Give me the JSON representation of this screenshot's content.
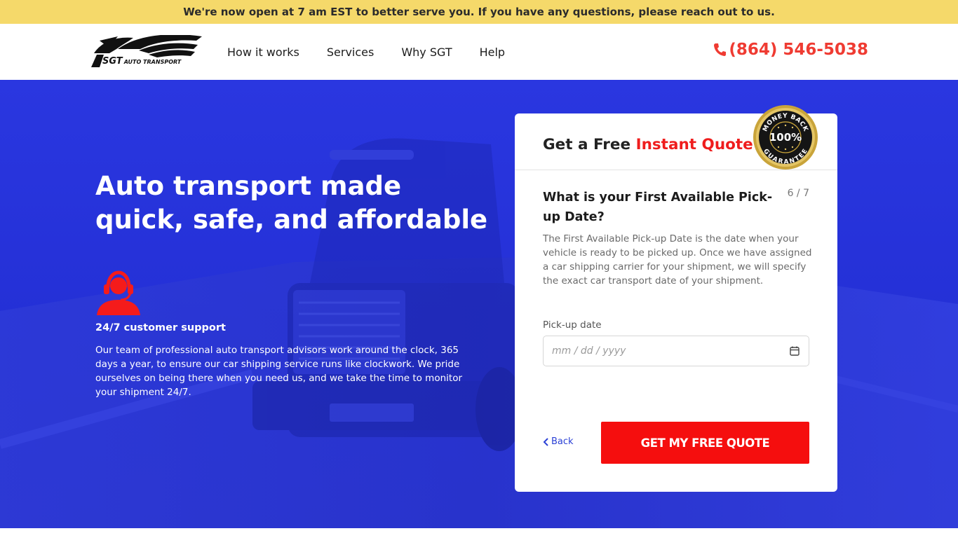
{
  "announcement": {
    "text": "We're now open at 7 am EST to better serve you. If you have any questions, please reach out to us."
  },
  "header": {
    "logo_text": "SGT",
    "logo_subtext": "AUTO TRANSPORT",
    "nav": [
      {
        "label": "How it works"
      },
      {
        "label": "Services"
      },
      {
        "label": "Why SGT"
      },
      {
        "label": "Help"
      }
    ],
    "phone": "(864) 546-5038",
    "phone_icon": "phone-icon",
    "phone_color": "#ef3b32"
  },
  "hero": {
    "title": "Auto transport made quick, safe, and affordable",
    "background_color": "#2430d8",
    "support": {
      "icon": "headset-agent-icon",
      "icon_color": "#f51b1b",
      "title": "24/7 customer support",
      "text": "Our team of professional auto transport advisors work around the clock, 365 days a year, to ensure our car shipping service runs like clockwork. We pride ourselves on being there when you need us, and we take the time to monitor your shipment 24/7."
    }
  },
  "quote_form": {
    "title_prefix": "Get a Free",
    "title_accent": "Instant Quote",
    "accent_color": "#ef1d1d",
    "badge": {
      "top": "MONEY BACK",
      "center": "100%",
      "bottom": "GUARANTEE"
    },
    "step": "6 / 7",
    "question": "What is your First Available Pick-up Date?",
    "description": "The First Available Pick-up Date is the date when your vehicle is ready to be picked up. Once we have assigned a car shipping carrier for your shipment, we will specify the exact car transport date of your shipment.",
    "field_label": "Pick-up date",
    "date_placeholder": "mm / dd / yyyy",
    "back_label": "Back",
    "submit_label": "GET MY FREE QUOTE",
    "submit_color": "#f50e0e"
  }
}
